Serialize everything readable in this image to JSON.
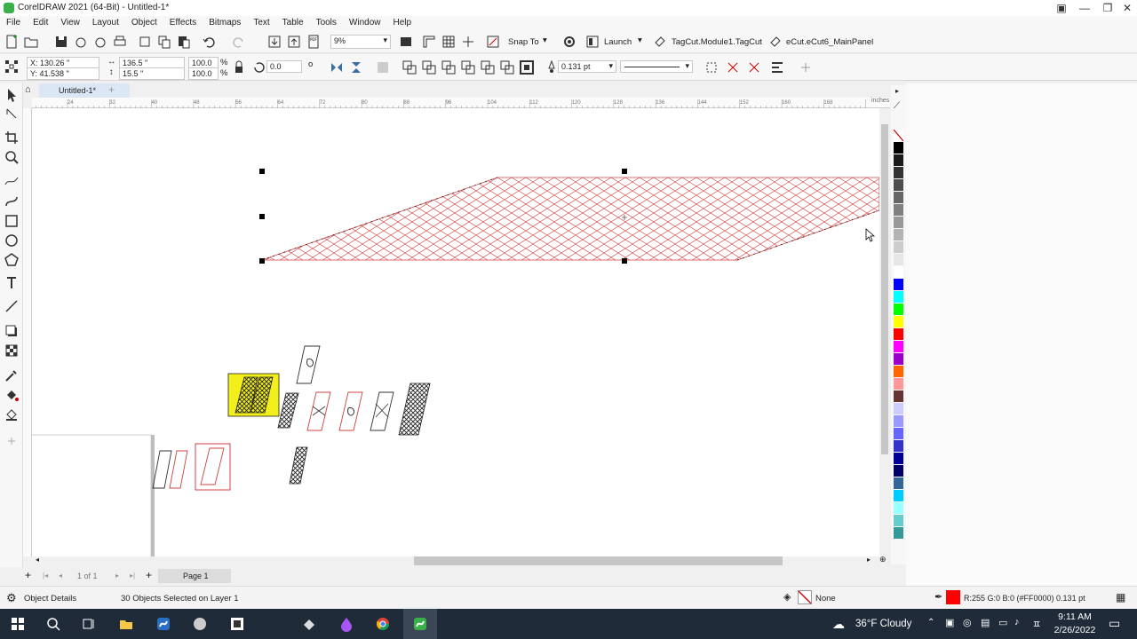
{
  "titlebar": {
    "title": "CorelDRAW 2021 (64-Bit) - Untitled-1*"
  },
  "menu": [
    "File",
    "Edit",
    "View",
    "Layout",
    "Object",
    "Effects",
    "Bitmaps",
    "Text",
    "Table",
    "Tools",
    "Window",
    "Help"
  ],
  "toolbar1": {
    "zoom": "9%",
    "snap_to": "Snap To",
    "launch": "Launch",
    "plugin1": "TagCut.Module1.TagCut",
    "plugin2": "eCut.eCut6_MainPanel"
  },
  "propertybar": {
    "x": "X: 130.26 \"",
    "y": "Y: 41.538 \"",
    "width": "136.5 \"",
    "height": "15.5 \"",
    "scale_x": "100.0",
    "scale_y": "100.0",
    "pct_x": "%",
    "pct_y": "%",
    "rotation": "0.0",
    "outline_width": "0.131 pt"
  },
  "doc_tab": "Untitled-1*",
  "ruler": {
    "unit": "inches",
    "ticks": [
      "24",
      "32",
      "40",
      "48",
      "56",
      "64",
      "72",
      "80",
      "88",
      "96",
      "104",
      "112",
      "120",
      "128",
      "136",
      "144",
      "152",
      "160",
      "168"
    ]
  },
  "pagenav": {
    "page_count": "1 of 1",
    "page_tab": "Page 1"
  },
  "status": {
    "object_details": "Object Details",
    "selection": "30 Objects Selected on Layer 1",
    "fill": "None",
    "outline": "R:255 G:0 B:0 (#FF0000)  0.131 pt",
    "outline_color": "#FF0000"
  },
  "taskbar": {
    "weather": "36°F  Cloudy",
    "time": "9:11 AM",
    "date": "2/26/2022"
  },
  "palette": [
    "#ffffff",
    "#000000",
    "#1a1a1a",
    "#333333",
    "#4d4d4d",
    "#666666",
    "#808080",
    "#999999",
    "#b3b3b3",
    "#cccccc",
    "#e6e6e6",
    "#ffffff",
    "#0000ff",
    "#00ffff",
    "#00ff00",
    "#ffff00",
    "#ff0000",
    "#ff00ff",
    "#9900cc",
    "#ff6600",
    "#ff9999",
    "#663333",
    "#ccccff",
    "#9999ff",
    "#6666ff",
    "#3333cc",
    "#000099",
    "#000066",
    "#336699",
    "#00ccff",
    "#99ffff",
    "#66cccc",
    "#339999"
  ]
}
